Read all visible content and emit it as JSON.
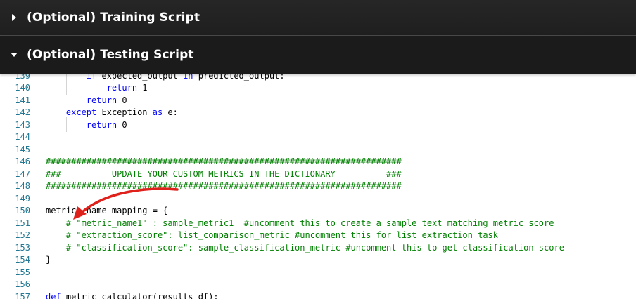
{
  "sections": {
    "training": {
      "title": "(Optional) Training Script",
      "state": "collapsed",
      "icon": "caret-right-icon"
    },
    "testing": {
      "title": "(Optional) Testing Script",
      "state": "expanded",
      "icon": "caret-down-icon"
    }
  },
  "colors": {
    "header_bg": "#1e1e1e",
    "header_text": "#ffffff",
    "line_number": "#237893",
    "keyword": "#0000ff",
    "comment": "#008000",
    "annotation_arrow": "#e0201b"
  },
  "editor": {
    "lines": [
      {
        "num": "139",
        "segments": [
          {
            "t": "        "
          },
          {
            "t": "if",
            "c": "kw"
          },
          {
            "t": " expected_output "
          },
          {
            "t": "in",
            "c": "kw"
          },
          {
            "t": " predicted_output:"
          }
        ]
      },
      {
        "num": "140",
        "segments": [
          {
            "t": "            "
          },
          {
            "t": "return",
            "c": "kw"
          },
          {
            "t": " 1"
          }
        ]
      },
      {
        "num": "141",
        "segments": [
          {
            "t": "        "
          },
          {
            "t": "return",
            "c": "kw"
          },
          {
            "t": " 0"
          }
        ]
      },
      {
        "num": "142",
        "segments": [
          {
            "t": "    "
          },
          {
            "t": "except",
            "c": "kw"
          },
          {
            "t": " Exception "
          },
          {
            "t": "as",
            "c": "kw"
          },
          {
            "t": " e:"
          }
        ]
      },
      {
        "num": "143",
        "segments": [
          {
            "t": "        "
          },
          {
            "t": "return",
            "c": "kw"
          },
          {
            "t": " 0"
          }
        ]
      },
      {
        "num": "144",
        "segments": []
      },
      {
        "num": "145",
        "segments": []
      },
      {
        "num": "146",
        "segments": [
          {
            "t": "######################################################################",
            "c": "cm"
          }
        ]
      },
      {
        "num": "147",
        "segments": [
          {
            "t": "###          UPDATE YOUR CUSTOM METRICS IN THE DICTIONARY          ###",
            "c": "cm"
          }
        ]
      },
      {
        "num": "148",
        "segments": [
          {
            "t": "######################################################################",
            "c": "cm"
          }
        ]
      },
      {
        "num": "149",
        "segments": []
      },
      {
        "num": "150",
        "segments": [
          {
            "t": "metrics_name_mapping = {"
          }
        ]
      },
      {
        "num": "151",
        "segments": [
          {
            "t": "    "
          },
          {
            "t": "# \"metric_name1\" : sample_metric1  #uncomment this to create a sample text matching metric score",
            "c": "cm"
          }
        ]
      },
      {
        "num": "152",
        "segments": [
          {
            "t": "    "
          },
          {
            "t": "# \"extraction_score\": list_comparison_metric #uncomment this for list extraction task",
            "c": "cm"
          }
        ]
      },
      {
        "num": "153",
        "segments": [
          {
            "t": "    "
          },
          {
            "t": "# \"classification_score\": sample_classification_metric #uncomment this to get classification score",
            "c": "cm"
          }
        ]
      },
      {
        "num": "154",
        "segments": [
          {
            "t": "}"
          }
        ]
      },
      {
        "num": "155",
        "segments": []
      },
      {
        "num": "156",
        "segments": []
      },
      {
        "num": "157",
        "segments": [
          {
            "t": "def",
            "c": "kw"
          },
          {
            "t": " metric_calculator(results_df):"
          }
        ]
      }
    ]
  }
}
